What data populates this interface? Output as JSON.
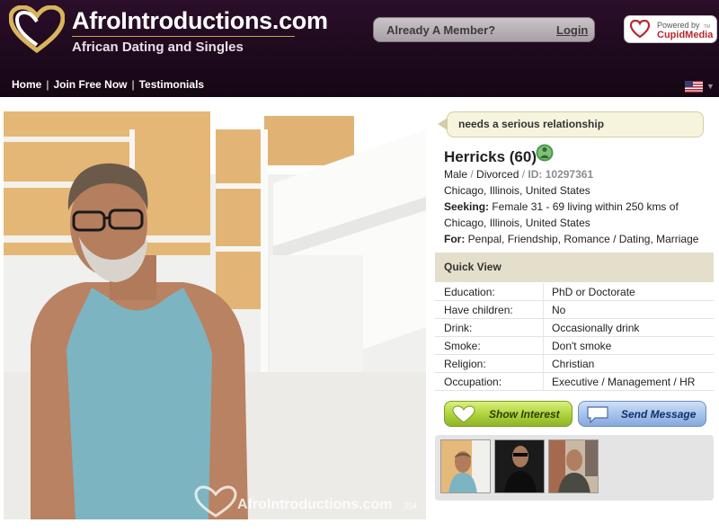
{
  "header": {
    "brand_name": "AfroIntroductions.com",
    "tagline": "African Dating and Singles",
    "member_prompt": "Already A Member?",
    "login_label": "Login",
    "cupid_powered": "Powered by",
    "cupid_name": "CupidMedia",
    "cupid_tm": "TM",
    "nav": [
      "Home",
      "Join Free Now",
      "Testimonials"
    ],
    "flag_icon": "us-flag-icon",
    "colors": {
      "header_bg": "#1e0a1d",
      "accent_gold": "#c9a24a",
      "cupid_red": "#b7282e"
    }
  },
  "photo": {
    "watermark_text": "AfroIntroductions.com",
    "photo_number": "354"
  },
  "profile": {
    "status": "needs a serious relationship",
    "name": "Herricks (60)",
    "gender": "Male",
    "slash1": " / ",
    "marital": "Divorced",
    "slash2": " / ",
    "id_label": "ID: 10297361",
    "location": "Chicago, Illinois, United States",
    "seeking_label": "Seeking:",
    "seeking_line1": " Female 31 - 69 living within 250 kms of",
    "seeking_line2": "Chicago, Illinois, United States",
    "for_label": "For:",
    "for_value": " Penpal, Friendship, Romance / Dating, Marriage",
    "online_icon": "online-status-icon"
  },
  "quick_view": {
    "title": "Quick View",
    "rows": [
      {
        "label": "Education:",
        "value": "PhD or Doctorate"
      },
      {
        "label": "Have children:",
        "value": "No"
      },
      {
        "label": "Drink:",
        "value": "Occasionally drink"
      },
      {
        "label": "Smoke:",
        "value": "Don't smoke"
      },
      {
        "label": "Religion:",
        "value": "Christian"
      },
      {
        "label": "Occupation:",
        "value": "Executive / Management / HR"
      }
    ]
  },
  "actions": {
    "interest_label": "Show Interest",
    "message_label": "Send Message"
  }
}
